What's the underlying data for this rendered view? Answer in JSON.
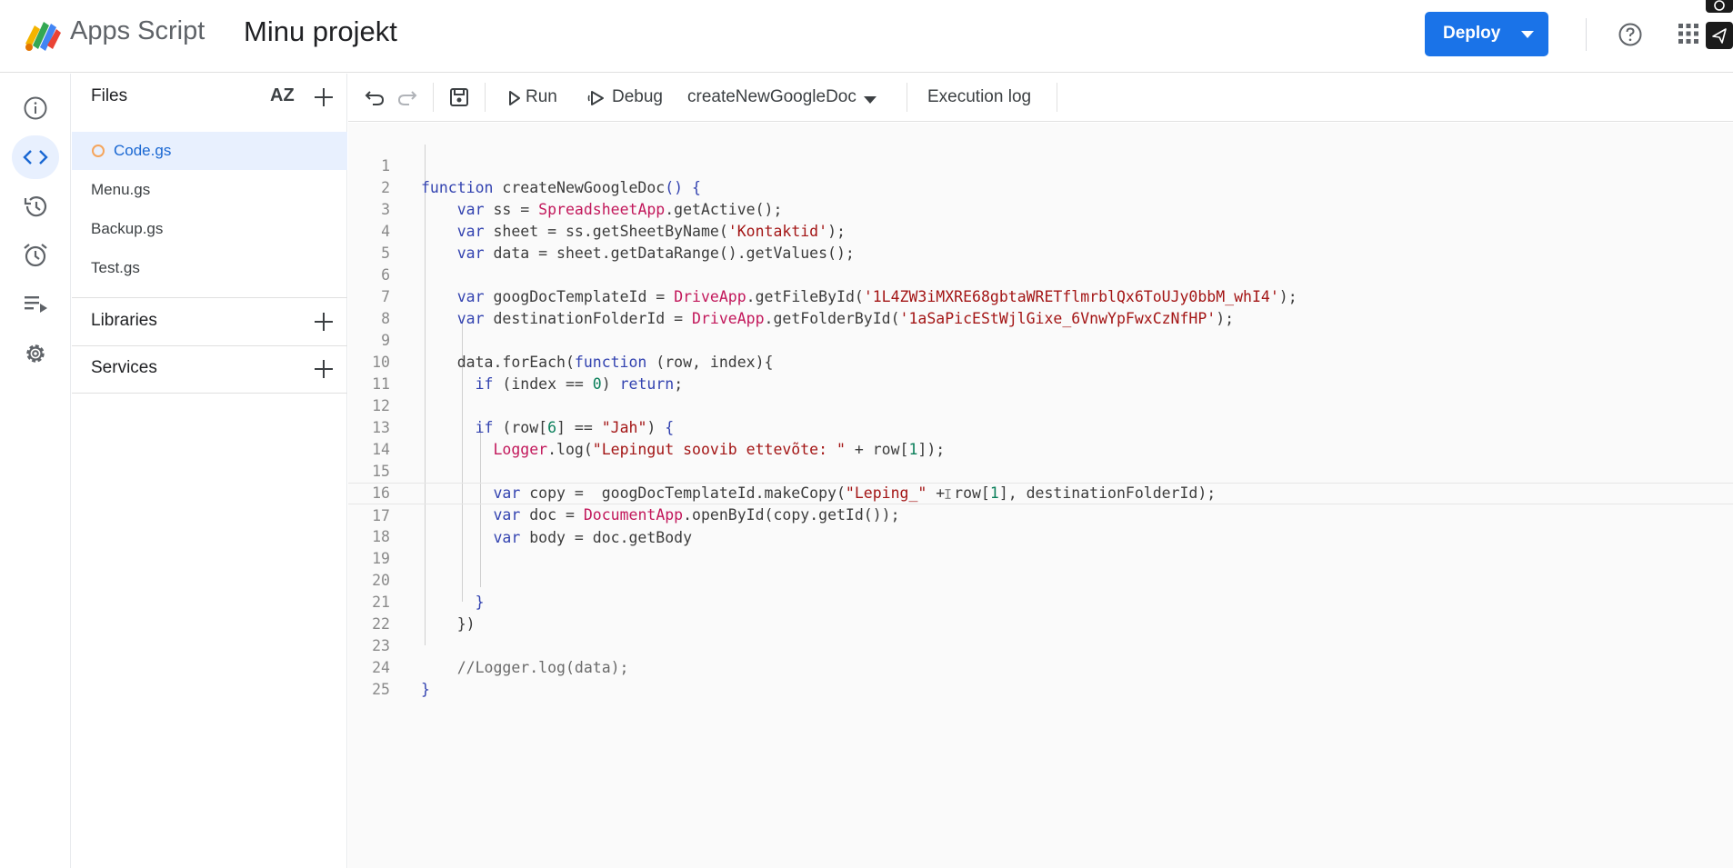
{
  "header": {
    "app_name": "Apps Script",
    "project_title": "Minu projekt",
    "deploy_label": "Deploy",
    "brand_color": "#1a73e8"
  },
  "rail": {
    "items": [
      {
        "icon": "info-icon",
        "label": "Overview"
      },
      {
        "icon": "code-icon",
        "label": "Editor",
        "active": true
      },
      {
        "icon": "history-icon",
        "label": "Project history"
      },
      {
        "icon": "alarm-icon",
        "label": "Triggers"
      },
      {
        "icon": "executions-icon",
        "label": "Executions"
      },
      {
        "icon": "gear-icon",
        "label": "Project Settings"
      }
    ]
  },
  "files_panel": {
    "files_title": "Files",
    "sort_label": "AZ",
    "files": [
      {
        "name": "Code.gs",
        "active": true,
        "unsaved": true
      },
      {
        "name": "Menu.gs"
      },
      {
        "name": "Backup.gs"
      },
      {
        "name": "Test.gs"
      }
    ],
    "libraries_title": "Libraries",
    "services_title": "Services"
  },
  "toolbar": {
    "run_label": "Run",
    "debug_label": "Debug",
    "function_select": "createNewGoogleDoc",
    "execution_log_label": "Execution log"
  },
  "editor": {
    "current_line": 17,
    "lines": [
      {
        "n": "1",
        "text": "function createNewGoogleDoc() {"
      },
      {
        "n": "2",
        "text": "    var ss = SpreadsheetApp.getActive();"
      },
      {
        "n": "3",
        "text": "    var sheet = ss.getSheetByName('Kontaktid');"
      },
      {
        "n": "4",
        "text": "    var data = sheet.getDataRange().getValues();"
      },
      {
        "n": "5",
        "text": ""
      },
      {
        "n": "6",
        "text": "    var googDocTemplateId = DriveApp.getFileById('1L4ZW3iMXRE68gbtaWRETflmrblQx6ToUJy0bbM_whI4');"
      },
      {
        "n": "7",
        "text": "    var destinationFolderId = DriveApp.getFolderById('1aSaPicEStWjlGixe_6VnwYpFwxCzNfHP');"
      },
      {
        "n": "8",
        "text": ""
      },
      {
        "n": "9",
        "text": "    data.forEach(function (row, index){"
      },
      {
        "n": "10",
        "text": "      if (index == 0) return;"
      },
      {
        "n": "11",
        "text": ""
      },
      {
        "n": "12",
        "text": "      if (row[6] == \"Jah\") {"
      },
      {
        "n": "13",
        "text": "        Logger.log(\"Lepingut soovib ettevõte: \" + row[1]);"
      },
      {
        "n": "14",
        "text": ""
      },
      {
        "n": "15",
        "text": "        var copy =  googDocTemplateId.makeCopy(\"Leping_\" + row[1], destinationFolderId);"
      },
      {
        "n": "16",
        "text": "        var doc = DocumentApp.openById(copy.getId());"
      },
      {
        "n": "17",
        "text": "        var body = doc.getBody"
      },
      {
        "n": "18",
        "text": ""
      },
      {
        "n": "19",
        "text": ""
      },
      {
        "n": "20",
        "text": "      }"
      },
      {
        "n": "21",
        "text": "    })"
      },
      {
        "n": "22",
        "text": ""
      },
      {
        "n": "23",
        "text": "    //Logger.log(data);"
      },
      {
        "n": "24",
        "text": "}"
      },
      {
        "n": "25",
        "text": ""
      }
    ]
  }
}
